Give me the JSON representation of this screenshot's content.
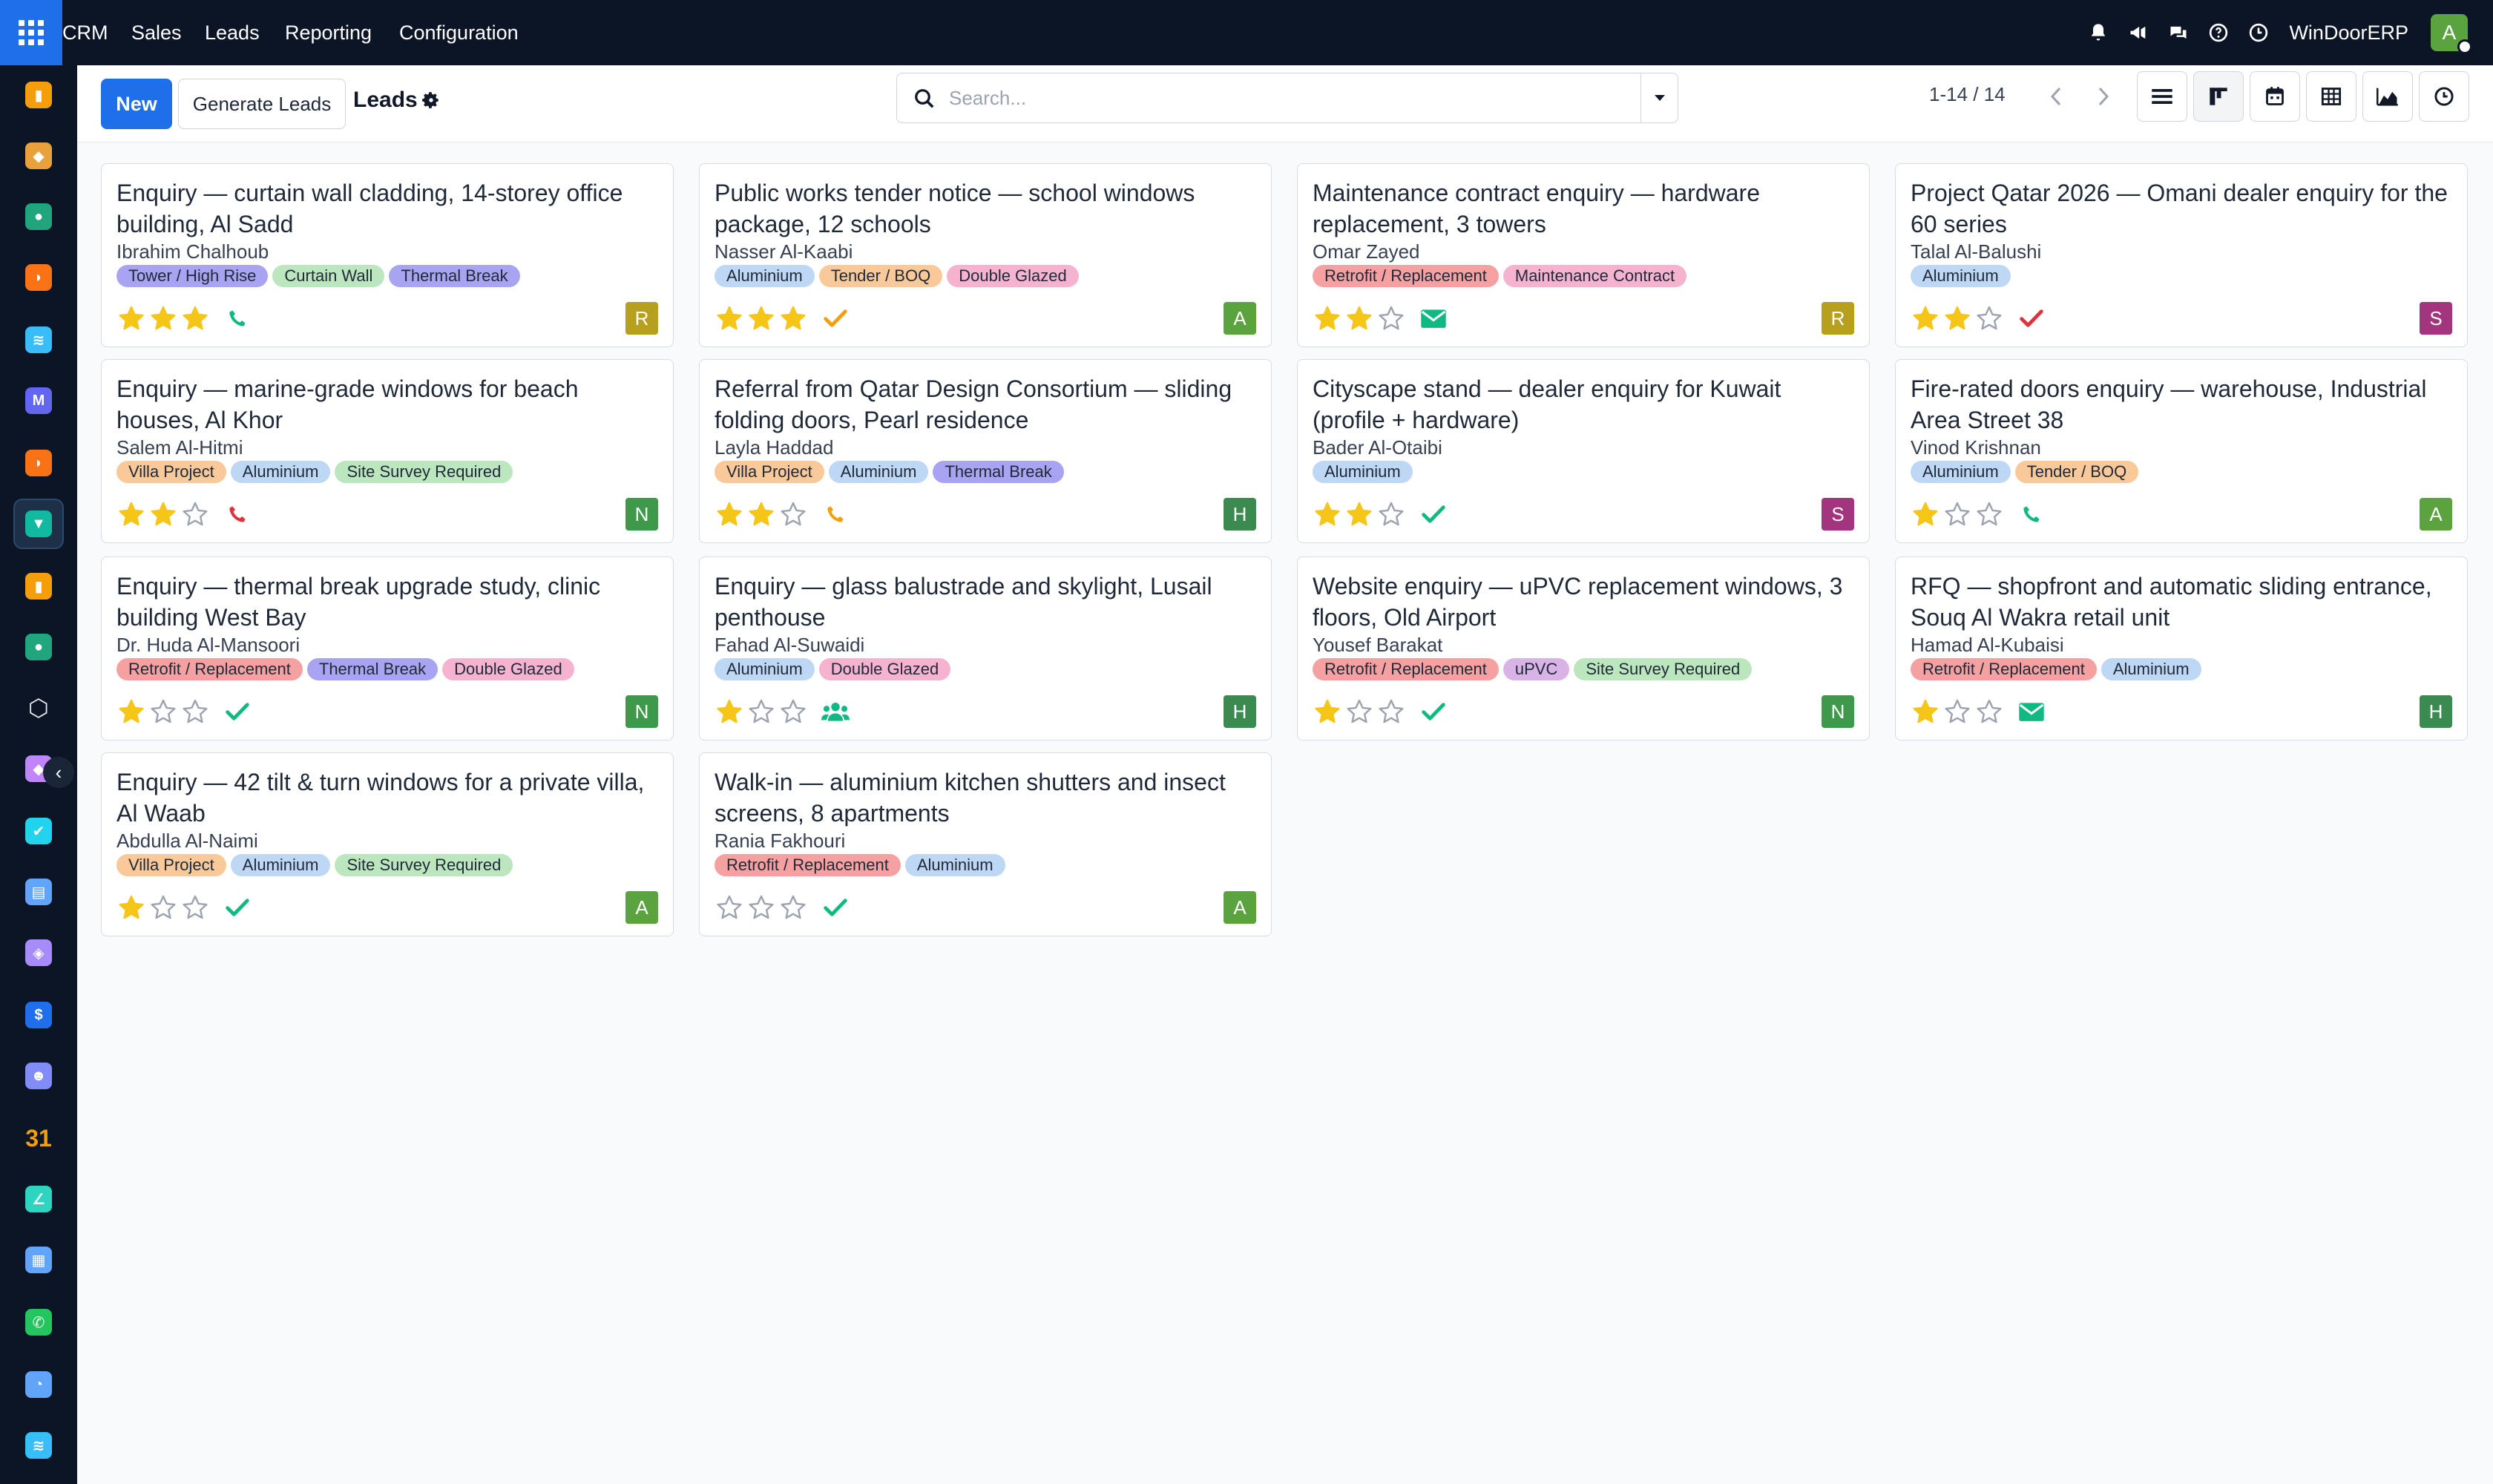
{
  "topbar": {
    "menu": [
      "CRM",
      "Sales",
      "Leads",
      "Reporting",
      "Configuration"
    ],
    "company": "WinDoorERP",
    "user_initial": "A"
  },
  "sidebar": {
    "apps": [
      "dashboard-app-icon",
      "documents-app-icon",
      "contacts-app-icon",
      "discuss-app-icon",
      "link-app-icon",
      "email-marketing-app-icon",
      "livechat-app-icon",
      "crm-app-icon",
      "reporting-app-icon",
      "employees-app-icon",
      "inventory-app-icon",
      "project-app-icon",
      "todo-app-icon",
      "knowledge-app-icon",
      "product-app-icon",
      "invoicing-app-icon",
      "team-app-icon",
      "calendar-app-icon",
      "sign-app-icon",
      "dashboard2-app-icon",
      "whatsapp-app-icon",
      "clock-app-icon",
      "link2-app-icon"
    ]
  },
  "controls": {
    "new_label": "New",
    "generate_label": "Generate Leads",
    "title": "Leads",
    "search_placeholder": "Search...",
    "pager": "1-14 / 14"
  },
  "tag_colors": {
    "Tower / High Rise": "#a8a4f2",
    "Curtain Wall": "#bce6be",
    "Thermal Break": "#a8a4f2",
    "Aluminium": "#bdd7f5",
    "Tender / BOQ": "#f9c99a",
    "Double Glazed": "#f6b3d0",
    "Retrofit / Replacement": "#f6a1a1",
    "Maintenance Contract": "#f6b3d0",
    "Villa Project": "#f9c99a",
    "Site Survey Required": "#bce6be",
    "uPVC": "#d9b3e6"
  },
  "leads": [
    {
      "title": "Enquiry — curtain wall cladding, 14-storey office building, Al Sadd",
      "contact": "Ibrahim Chalhoub",
      "tags": [
        "Tower / High Rise",
        "Curtain Wall",
        "Thermal Break"
      ],
      "stars": 3,
      "activity": "phone-icon",
      "activity_color": "#10b981",
      "owner": "R",
      "owner_color": "#b7a01d"
    },
    {
      "title": "Public works tender notice — school windows package, 12 schools",
      "contact": "Nasser Al-Kaabi",
      "tags": [
        "Aluminium",
        "Tender / BOQ",
        "Double Glazed"
      ],
      "stars": 3,
      "activity": "check-icon",
      "activity_color": "#f59e0b",
      "owner": "A",
      "owner_color": "#5aa33f"
    },
    {
      "title": "Maintenance contract enquiry — hardware replacement, 3 towers",
      "contact": "Omar Zayed",
      "tags": [
        "Retrofit / Replacement",
        "Maintenance Contract"
      ],
      "stars": 2,
      "activity": "email-icon",
      "activity_color": "#10b981",
      "owner": "R",
      "owner_color": "#b7a01d"
    },
    {
      "title": "Project Qatar 2026 — Omani dealer enquiry for the 60 series",
      "contact": "Talal Al-Balushi",
      "tags": [
        "Aluminium"
      ],
      "stars": 2,
      "activity": "check-icon",
      "activity_color": "#e0323b",
      "owner": "S",
      "owner_color": "#a2357d"
    },
    {
      "title": "Enquiry — marine-grade windows for beach houses, Al Khor",
      "contact": "Salem Al-Hitmi",
      "tags": [
        "Villa Project",
        "Aluminium",
        "Site Survey Required"
      ],
      "stars": 2,
      "activity": "phone-icon",
      "activity_color": "#e0323b",
      "owner": "N",
      "owner_color": "#3e9a4a"
    },
    {
      "title": "Referral from Qatar Design Consortium — sliding folding doors, Pearl residence",
      "contact": "Layla Haddad",
      "tags": [
        "Villa Project",
        "Aluminium",
        "Thermal Break"
      ],
      "stars": 2,
      "activity": "phone-icon",
      "activity_color": "#f59e0b",
      "owner": "H",
      "owner_color": "#3b8a4f"
    },
    {
      "title": "Cityscape stand — dealer enquiry for Kuwait (profile + hardware)",
      "contact": "Bader Al-Otaibi",
      "tags": [
        "Aluminium"
      ],
      "stars": 2,
      "activity": "check-icon",
      "activity_color": "#10b981",
      "owner": "S",
      "owner_color": "#a2357d"
    },
    {
      "title": "Fire-rated doors enquiry — warehouse, Industrial Area Street 38",
      "contact": "Vinod Krishnan",
      "tags": [
        "Aluminium",
        "Tender / BOQ"
      ],
      "stars": 1,
      "activity": "phone-icon",
      "activity_color": "#10b981",
      "owner": "A",
      "owner_color": "#5aa33f"
    },
    {
      "title": "Enquiry — thermal break upgrade study, clinic building West Bay",
      "contact": "Dr. Huda Al-Mansoori",
      "tags": [
        "Retrofit / Replacement",
        "Thermal Break",
        "Double Glazed"
      ],
      "stars": 1,
      "activity": "check-icon",
      "activity_color": "#10b981",
      "owner": "N",
      "owner_color": "#3e9a4a"
    },
    {
      "title": "Enquiry — glass balustrade and skylight, Lusail penthouse",
      "contact": "Fahad Al-Suwaidi",
      "tags": [
        "Aluminium",
        "Double Glazed"
      ],
      "stars": 1,
      "activity": "users-icon",
      "activity_color": "#10b981",
      "owner": "H",
      "owner_color": "#3b8a4f"
    },
    {
      "title": "Website enquiry — uPVC replacement windows, 3 floors, Old Airport",
      "contact": "Yousef Barakat",
      "tags": [
        "Retrofit / Replacement",
        "uPVC",
        "Site Survey Required"
      ],
      "stars": 1,
      "activity": "check-icon",
      "activity_color": "#10b981",
      "owner": "N",
      "owner_color": "#3e9a4a"
    },
    {
      "title": "RFQ — shopfront and automatic sliding entrance, Souq Al Wakra retail unit",
      "contact": "Hamad Al-Kubaisi",
      "tags": [
        "Retrofit / Replacement",
        "Aluminium"
      ],
      "stars": 1,
      "activity": "email-icon",
      "activity_color": "#10b981",
      "owner": "H",
      "owner_color": "#3b8a4f"
    },
    {
      "title": "Enquiry — 42 tilt & turn windows for a private villa, Al Waab",
      "contact": "Abdulla Al-Naimi",
      "tags": [
        "Villa Project",
        "Aluminium",
        "Site Survey Required"
      ],
      "stars": 1,
      "activity": "check-icon",
      "activity_color": "#10b981",
      "owner": "A",
      "owner_color": "#5aa33f"
    },
    {
      "title": "Walk-in — aluminium kitchen shutters and insect screens, 8 apartments",
      "contact": "Rania Fakhouri",
      "tags": [
        "Retrofit / Replacement",
        "Aluminium"
      ],
      "stars": 0,
      "activity": "check-icon",
      "activity_color": "#10b981",
      "owner": "A",
      "owner_color": "#5aa33f"
    }
  ]
}
